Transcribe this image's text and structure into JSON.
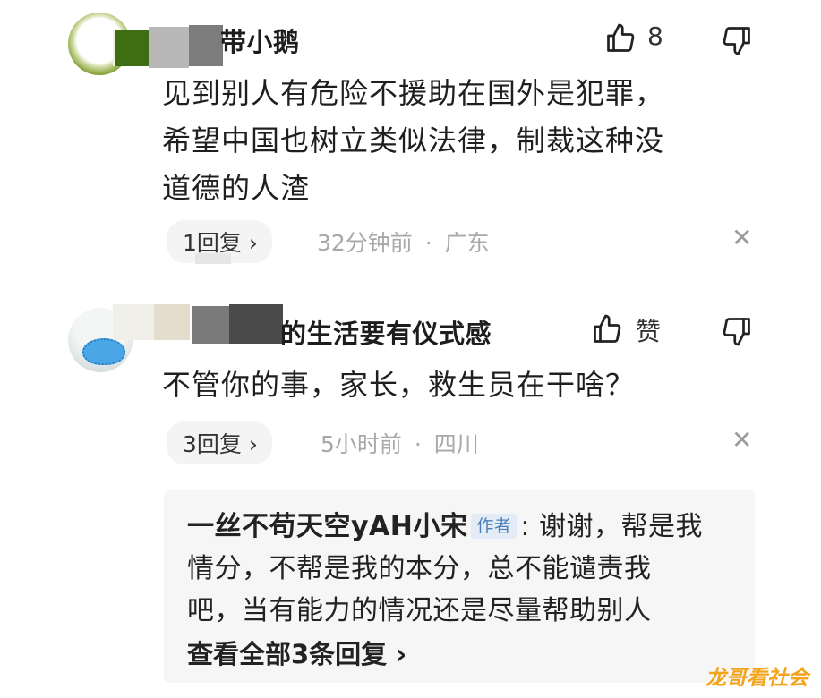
{
  "comments": [
    {
      "username": "带小鹅",
      "likes": "8",
      "content_lines": [
        "见到别人有危险不援助在国外是犯罪，",
        "希望中国也树立类似法律，制裁这种没",
        "道德的人渣"
      ],
      "reply_count": "1回复",
      "time": "32分钟前",
      "location": "广东"
    },
    {
      "username": "的生活要有仪式感",
      "likes": "赞",
      "content_lines": [
        "不管你的事，家长，救生员在干啥？"
      ],
      "reply_count": "3回复",
      "time": "5小时前",
      "location": "四川",
      "top_reply": {
        "author": "一丝不苟天空yAH小宋",
        "badge": "作者",
        "text_lines": [
          ": 谢谢，帮是我",
          "情分，不帮是我的本分，总不能谴责我",
          "吧，当有能力的情况还是尽量帮助别人"
        ],
        "view_all": "查看全部3条回复"
      }
    }
  ],
  "separator": "·",
  "chevron": "›",
  "close_glyph": "✕",
  "watermark": "龙哥看社会",
  "icons": [
    "thumbs-up-icon",
    "thumbs-down-icon",
    "close-icon",
    "chevron-right-icon"
  ]
}
